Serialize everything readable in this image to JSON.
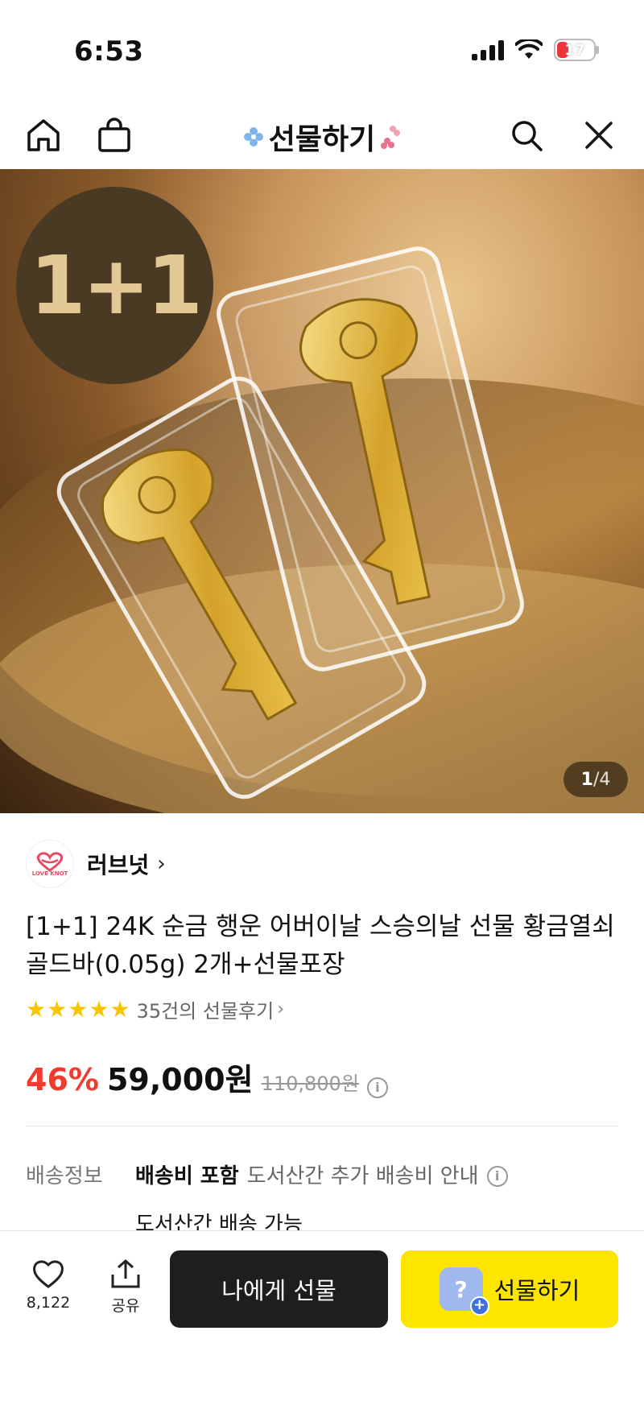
{
  "status_bar": {
    "time": "6:53",
    "battery": "17"
  },
  "header": {
    "title": "선물하기"
  },
  "hero": {
    "badge": "1+1",
    "page_current": "1",
    "page_total": "/4"
  },
  "seller": {
    "name": "러브넛",
    "logo_text": "LOVE KNOT"
  },
  "product": {
    "title": "[1+1] 24K 순금 행운 어버이날 스승의날 선물 황금열쇠 골드바(0.05g) 2개+선물포장",
    "rating_stars": 5,
    "review_text": "35건의 선물후기",
    "discount": "46%",
    "price": "59,000원",
    "original_price": "110,800원"
  },
  "shipping": {
    "label": "배송정보",
    "included": "배송비 포함",
    "notice": "도서산간 추가 배송비 안내",
    "extra": "도서산간 배송 가능"
  },
  "bottom_bar": {
    "like_count": "8,122",
    "share_label": "공유",
    "self_gift_label": "나에게 선물",
    "gift_label": "선물하기"
  },
  "colors": {
    "discount": "#f03b2f",
    "gift_button": "#fde500",
    "self_button": "#1e1e1e",
    "star": "#f7c600"
  }
}
